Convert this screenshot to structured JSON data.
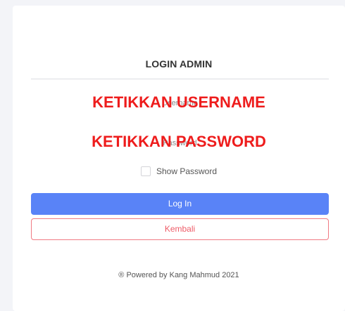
{
  "login": {
    "title": "LOGIN ADMIN",
    "username": {
      "placeholder": "Username",
      "overlay": "KETIKKAN USERNAME"
    },
    "password": {
      "placeholder": "Password",
      "overlay": "KETIKKAN PASSWORD"
    },
    "show_password_label": "Show Password",
    "login_button": "Log In",
    "back_button": "Kembali",
    "footer": "® Powered by Kang Mahmud 2021"
  },
  "colors": {
    "primary": "#5983f7",
    "danger": "#ee5c68",
    "overlay_red": "#ee1c1c",
    "background": "#f3f4f8"
  }
}
